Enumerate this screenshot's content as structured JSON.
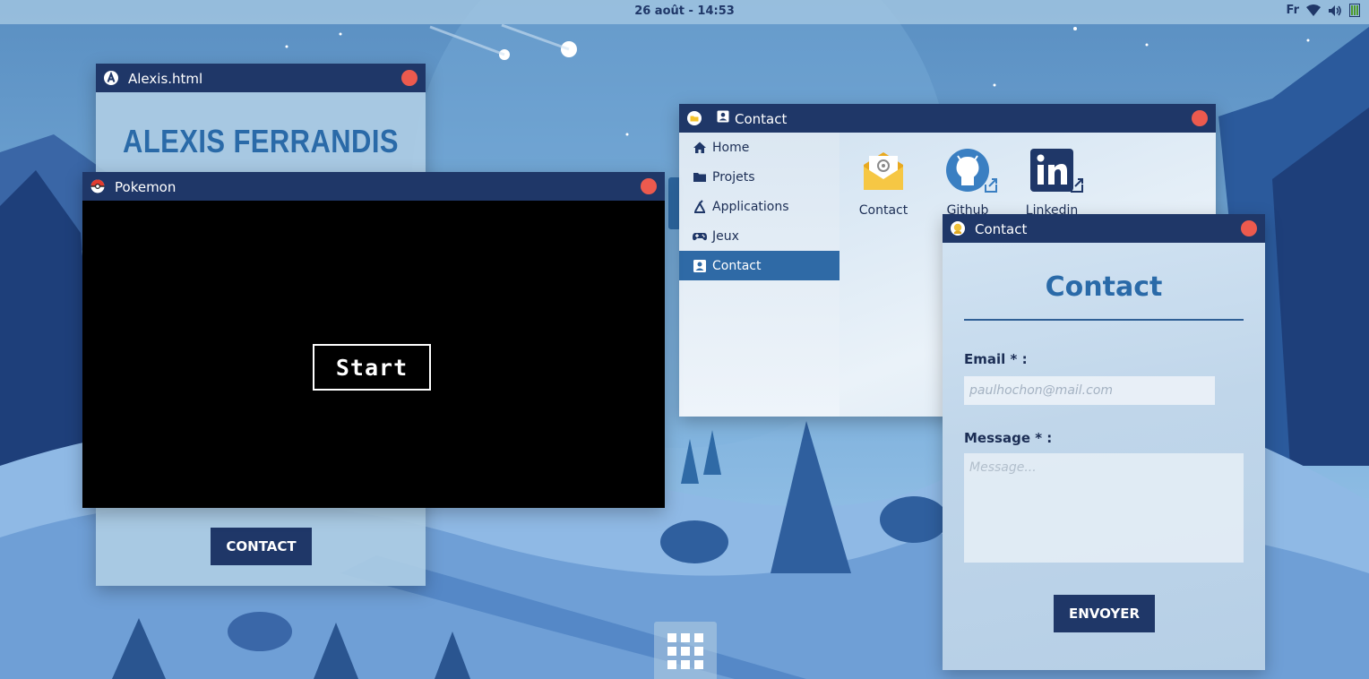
{
  "topbar": {
    "clock": "26 août - 14:53",
    "language": "Fr",
    "icons": [
      "wifi-icon",
      "volume-icon",
      "battery-icon"
    ]
  },
  "windows": {
    "alexis": {
      "title": "Alexis.html",
      "heading": "ALEXIS FERRANDIS",
      "contact_button": "CONTACT"
    },
    "pokemon": {
      "title": "Pokemon",
      "start_button": "Start"
    },
    "explorer": {
      "title": "Contact",
      "sidebar": [
        {
          "label": "Home",
          "icon": "home-icon"
        },
        {
          "label": "Projets",
          "icon": "folder-icon"
        },
        {
          "label": "Applications",
          "icon": "applications-icon"
        },
        {
          "label": "Jeux",
          "icon": "gamepad-icon"
        },
        {
          "label": "Contact",
          "icon": "contact-card-icon",
          "active": true
        }
      ],
      "tiles": [
        {
          "label": "Contact",
          "icon": "mail-envelope-icon"
        },
        {
          "label": "Github",
          "icon": "github-icon"
        },
        {
          "label": "Linkedin",
          "icon": "linkedin-icon"
        }
      ]
    },
    "form": {
      "title": "Contact",
      "heading": "Contact",
      "email_label": "Email * :",
      "email_placeholder": "paulhochon@mail.com",
      "message_label": "Message * :",
      "message_placeholder": "Message...",
      "submit_button": "ENVOYER"
    }
  },
  "dock": {
    "icon": "app-grid-icon"
  },
  "colors": {
    "titlebar": "#1f3768",
    "close": "#ec5a4e",
    "accent": "#2a6aa8",
    "active_item": "#2f6aa6"
  }
}
